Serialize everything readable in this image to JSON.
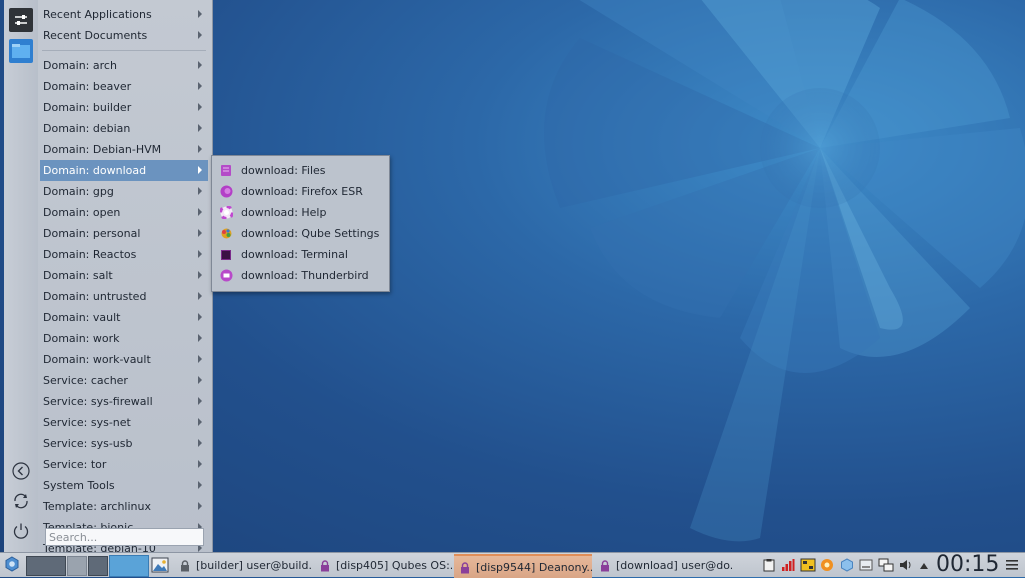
{
  "menu": {
    "items": [
      {
        "label": "Recent Applications"
      },
      {
        "label": "Recent Documents"
      },
      {
        "label": "Domain: arch"
      },
      {
        "label": "Domain: beaver"
      },
      {
        "label": "Domain: builder"
      },
      {
        "label": "Domain: debian"
      },
      {
        "label": "Domain: Debian-HVM"
      },
      {
        "label": "Domain: download",
        "active": true
      },
      {
        "label": "Domain: gpg"
      },
      {
        "label": "Domain: open"
      },
      {
        "label": "Domain: personal"
      },
      {
        "label": "Domain: Reactos"
      },
      {
        "label": "Domain: salt"
      },
      {
        "label": "Domain: untrusted"
      },
      {
        "label": "Domain: vault"
      },
      {
        "label": "Domain: work"
      },
      {
        "label": "Domain: work-vault"
      },
      {
        "label": "Service: cacher"
      },
      {
        "label": "Service: sys-firewall"
      },
      {
        "label": "Service: sys-net"
      },
      {
        "label": "Service: sys-usb"
      },
      {
        "label": "Service: tor"
      },
      {
        "label": "System Tools"
      },
      {
        "label": "Template: archlinux"
      },
      {
        "label": "Template: bionic"
      },
      {
        "label": "Template: debian-10"
      }
    ],
    "search_placeholder": "Search..."
  },
  "submenu": {
    "items": [
      {
        "label": "download: Files",
        "icon": "files-icon",
        "color": "#b44bc8"
      },
      {
        "label": "download: Firefox ESR",
        "icon": "firefox-icon",
        "color": "#b33fc7"
      },
      {
        "label": "download: Help",
        "icon": "help-icon",
        "color": "#c04ad0"
      },
      {
        "label": "download: Qube Settings",
        "icon": "qube-settings-icon",
        "color": "#e0a020"
      },
      {
        "label": "download: Terminal",
        "icon": "terminal-icon",
        "color": "#7a2a8a"
      },
      {
        "label": "download: Thunderbird",
        "icon": "thunderbird-icon",
        "color": "#b84ac9"
      }
    ]
  },
  "taskbar": {
    "tasks": [
      {
        "label": "[builder] user@build...",
        "lock_color": "#5a5f66"
      },
      {
        "label": "[disp405] Qubes OS:...",
        "lock_color": "#8a3f9a"
      },
      {
        "label": "[disp9544] Deanony...",
        "lock_color": "#8a3f9a",
        "active": true
      },
      {
        "label": "[download] user@do...",
        "lock_color": "#8a3f9a"
      }
    ],
    "clock": "00:15"
  }
}
